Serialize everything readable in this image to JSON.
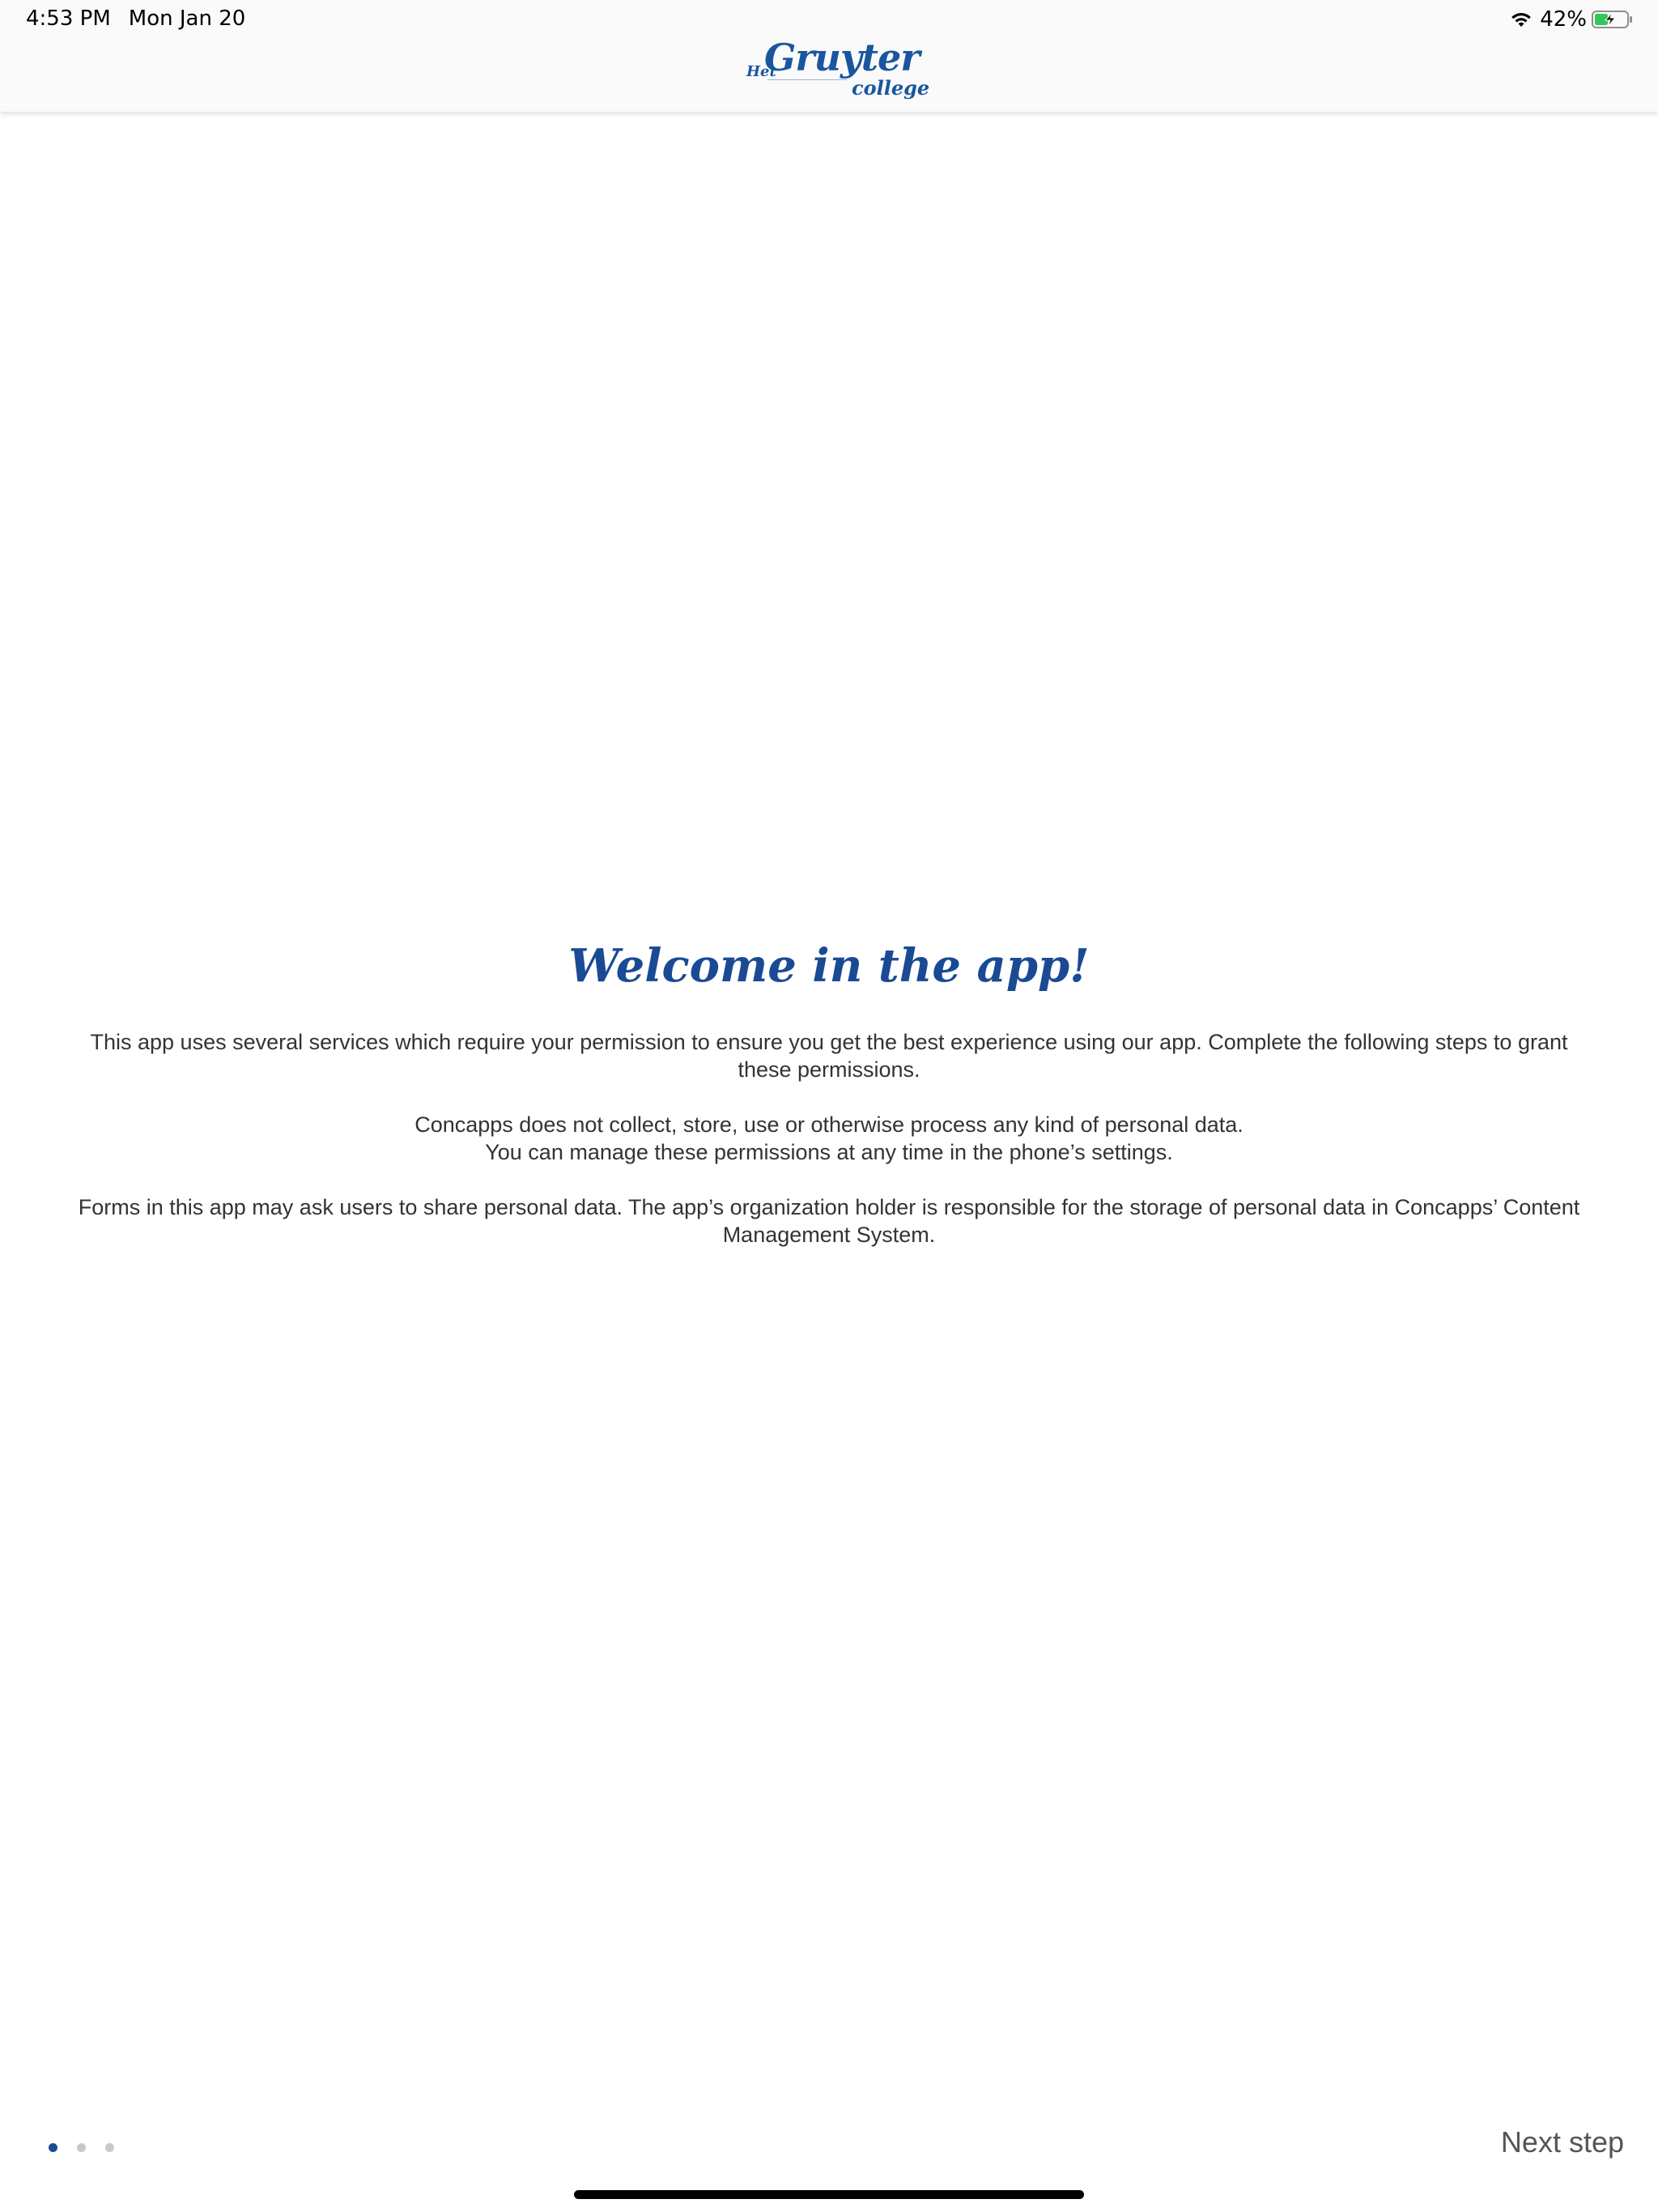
{
  "status_bar": {
    "time": "4:53 PM",
    "date": "Mon Jan 20",
    "battery_percent": "42%",
    "battery_level": 0.42,
    "icons": [
      "wifi-icon",
      "battery-charging-icon"
    ]
  },
  "header": {
    "logo": {
      "het": "Het",
      "main": "Gruyter",
      "sub": "college"
    }
  },
  "main": {
    "title": "Welcome in the app!",
    "paragraphs": [
      "This app uses several services which require your permission to ensure you get the best experience using our app. Complete the following steps to grant these permissions.",
      "Concapps does not collect, store, use or otherwise process any kind of personal data.",
      "You can manage these permissions at any time in the phone’s settings.",
      "Forms in this app may ask users to share personal data. The app’s organization holder is responsible for the storage of personal data in Concapps’ Content Management System."
    ]
  },
  "footer": {
    "page_indicator": {
      "total": 3,
      "current": 1
    },
    "next_label": "Next step"
  },
  "colors": {
    "brand": "#1a4a94",
    "logo": "#1a56a0",
    "text": "#333333",
    "dot_active": "#1a4a94",
    "dot_inactive": "#c9c9cc"
  }
}
